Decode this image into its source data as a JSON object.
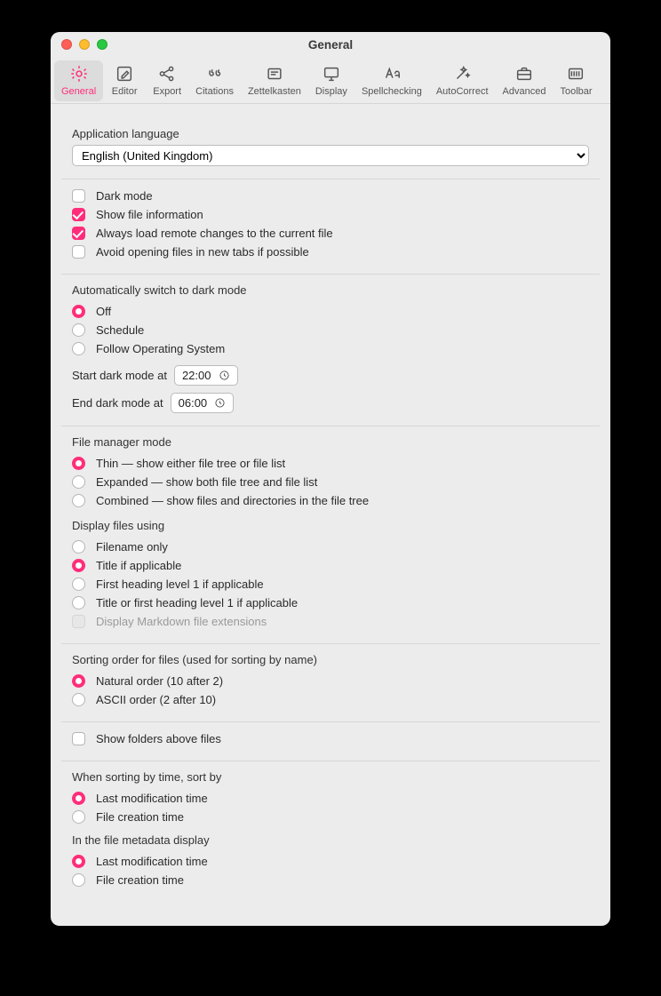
{
  "window": {
    "title": "General"
  },
  "tabs": [
    {
      "id": "general",
      "label": "General"
    },
    {
      "id": "editor",
      "label": "Editor"
    },
    {
      "id": "export",
      "label": "Export"
    },
    {
      "id": "citations",
      "label": "Citations"
    },
    {
      "id": "zettelkasten",
      "label": "Zettelkasten"
    },
    {
      "id": "display",
      "label": "Display"
    },
    {
      "id": "spellchecking",
      "label": "Spellchecking"
    },
    {
      "id": "autocorrect",
      "label": "AutoCorrect"
    },
    {
      "id": "advanced",
      "label": "Advanced"
    },
    {
      "id": "toolbar",
      "label": "Toolbar"
    }
  ],
  "lang": {
    "label": "Application language",
    "value": "English (United Kingdom)"
  },
  "checks": {
    "darkmode": {
      "label": "Dark mode",
      "checked": false
    },
    "fileinfo": {
      "label": "Show file information",
      "checked": true
    },
    "remote": {
      "label": "Always load remote changes to the current file",
      "checked": true
    },
    "avoidtabs": {
      "label": "Avoid opening files in new tabs if possible",
      "checked": false
    }
  },
  "autodark": {
    "heading": "Automatically switch to dark mode",
    "off": "Off",
    "schedule": "Schedule",
    "follow": "Follow Operating System",
    "selected": "off",
    "start_label": "Start dark mode at",
    "start_value": "22:00",
    "end_label": "End dark mode at",
    "end_value": "06:00"
  },
  "fmm": {
    "heading": "File manager mode",
    "thin": "Thin — show either file tree or file list",
    "expanded": "Expanded — show both file tree and file list",
    "combined": "Combined — show files and directories in the file tree",
    "selected": "thin"
  },
  "dfu": {
    "heading": "Display files using",
    "filename": "Filename only",
    "title": "Title if applicable",
    "h1": "First heading level 1 if applicable",
    "titleh1": "Title or first heading level 1 if applicable",
    "selected": "title",
    "mdext": {
      "label": "Display Markdown file extensions",
      "disabled": true
    }
  },
  "sort": {
    "heading": "Sorting order for files (used for sorting by name)",
    "natural": "Natural order (10 after 2)",
    "ascii": "ASCII order (2 after 10)",
    "selected": "natural"
  },
  "foldersAbove": {
    "label": "Show folders above files",
    "checked": false
  },
  "timesort": {
    "heading": "When sorting by time, sort by",
    "mod": "Last modification time",
    "creat": "File creation time",
    "selected": "mod"
  },
  "metadisplay": {
    "heading": "In the file metadata display",
    "mod": "Last modification time",
    "creat": "File creation time",
    "selected": "mod"
  }
}
